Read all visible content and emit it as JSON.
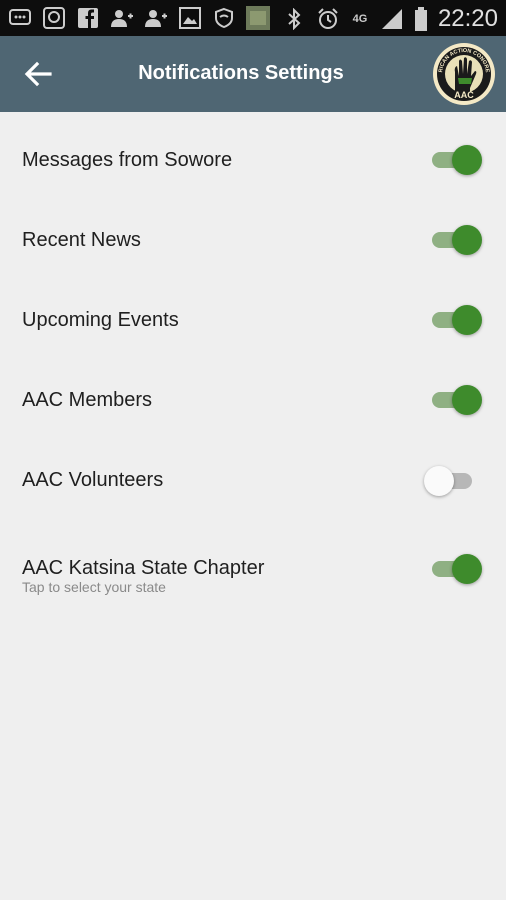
{
  "status_bar": {
    "time": "22:20",
    "network": "4G",
    "left_icons": [
      "message-icon",
      "bbm-icon",
      "facebook-icon",
      "add-user-icon",
      "add-user-icon",
      "gallery-icon",
      "shield-icon",
      "photo-icon"
    ],
    "right_icons": [
      "bluetooth-icon",
      "alarm-icon",
      "signal-icon",
      "battery-icon"
    ]
  },
  "appbar": {
    "title": "Notifications Settings",
    "back_icon": "arrow-left-icon",
    "logo_text_top": "AFRICAN ACTION CONGRESS",
    "logo_text_bottom": "AAC"
  },
  "settings": [
    {
      "label": "Messages from Sowore",
      "enabled": true
    },
    {
      "label": "Recent News",
      "enabled": true
    },
    {
      "label": "Upcoming Events",
      "enabled": true
    },
    {
      "label": "AAC Members",
      "enabled": true
    },
    {
      "label": "AAC Volunteers",
      "enabled": false
    },
    {
      "label": "AAC Katsina State Chapter",
      "sublabel": "Tap to select your state",
      "enabled": true
    }
  ],
  "colors": {
    "appbar": "#4f6673",
    "switch_on_thumb": "#3e8b2c",
    "switch_on_track": "#8fb083",
    "switch_off_track": "#b7b7b7",
    "background": "#efefef"
  }
}
